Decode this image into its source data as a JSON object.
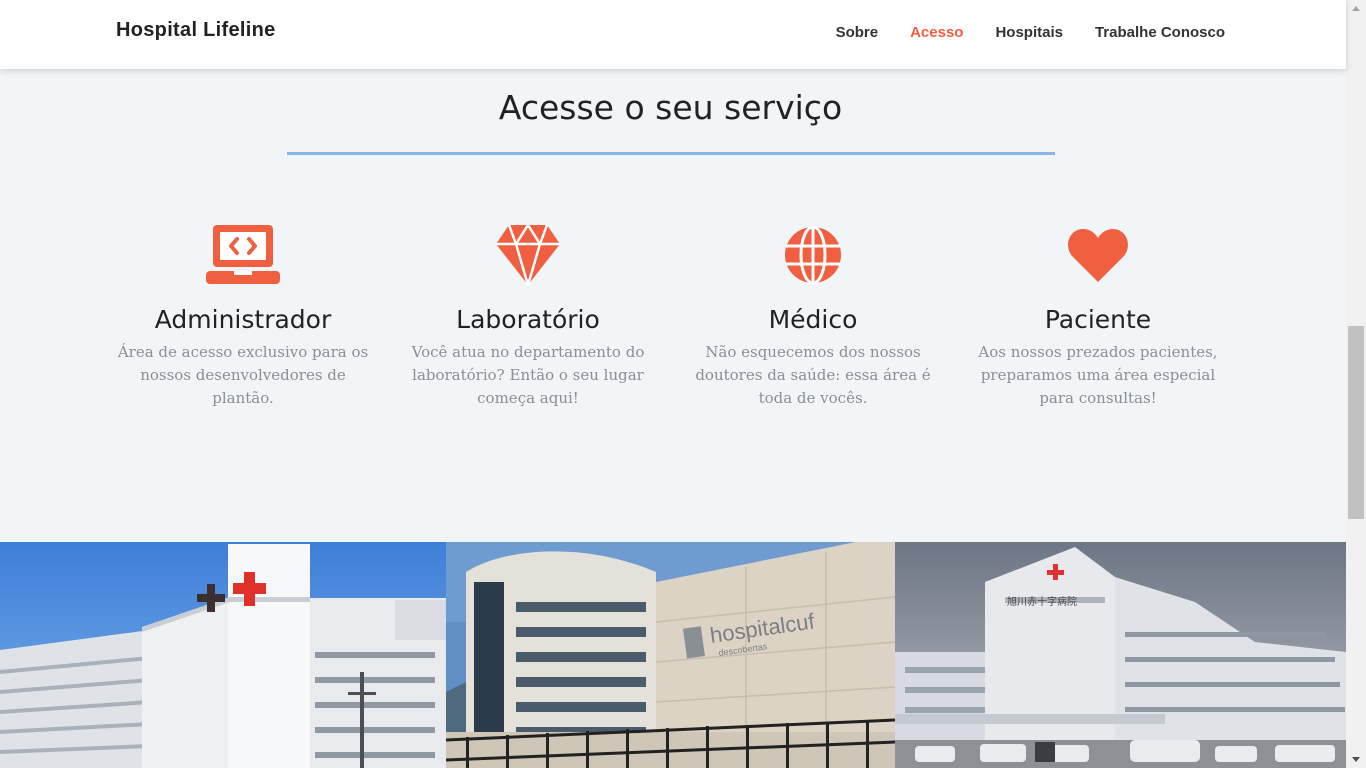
{
  "brand": "Hospital Lifeline",
  "nav": [
    {
      "label": "Sobre",
      "active": false
    },
    {
      "label": "Acesso",
      "active": true
    },
    {
      "label": "Hospitais",
      "active": false
    },
    {
      "label": "Trabalhe Conosco",
      "active": false
    }
  ],
  "section": {
    "title": "Acesse o seu serviço"
  },
  "services": [
    {
      "icon": "laptop-code-icon",
      "title": "Administrador",
      "text": "Área de acesso exclusivo para os nossos desenvolvedores de plantão."
    },
    {
      "icon": "diamond-icon",
      "title": "Laboratório",
      "text": "Você atua no departamento do laboratório? Então o seu lugar começa aqui!"
    },
    {
      "icon": "globe-icon",
      "title": "Médico",
      "text": "Não esquecemos dos nossos doutores da saúde: essa área é toda de vocês."
    },
    {
      "icon": "heart-icon",
      "title": "Paciente",
      "text": "Aos nossos prezados pacientes, preparamos uma área especial para consultas!"
    }
  ],
  "gallery": [
    {
      "sign": ""
    },
    {
      "sign": "hospitalcuf",
      "subsign": "descobertas"
    },
    {
      "sign": "旭川赤十字病院"
    }
  ],
  "colors": {
    "accent": "#f05f40",
    "divider": "#8ab8e6",
    "background": "#f2f5f8"
  }
}
